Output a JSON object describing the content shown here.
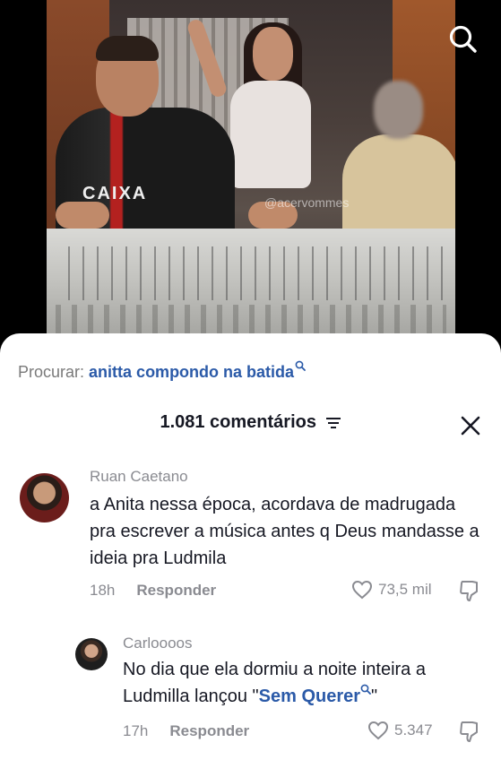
{
  "video": {
    "watermark": "@acervommes",
    "shirt_text": "CAIXA"
  },
  "search_suggestion": {
    "prefix": "Procurar:",
    "term": "anitta compondo na batida"
  },
  "comments_header": {
    "count_label": "1.081 comentários"
  },
  "comments": [
    {
      "author": "Ruan Caetano",
      "text": "a Anita nessa época, acordava de madrugada pra escrever a música antes q Deus mandasse a ideia pra Ludmila",
      "time": "18h",
      "reply_label": "Responder",
      "likes": "73,5 mil"
    },
    {
      "author": "Carloooos",
      "text_before": "No dia que ela dormiu a noite inteira a Ludmilla lançou \"",
      "link_text": "Sem Querer",
      "text_after": "\"",
      "time": "17h",
      "reply_label": "Responder",
      "likes": "5.347"
    }
  ],
  "colors": {
    "link": "#2b5aa8",
    "muted": "#8a8b91",
    "text": "#161823"
  }
}
